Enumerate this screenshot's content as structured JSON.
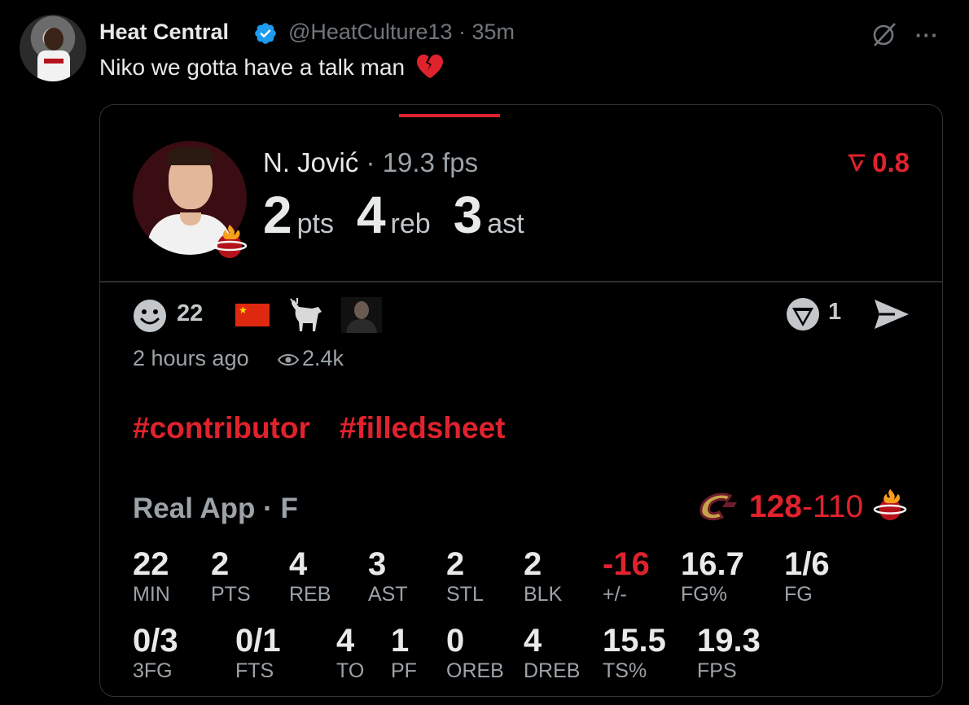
{
  "tweet": {
    "display_name": "Heat Central",
    "handle_time": "@HeatCulture13 · 35m",
    "text": "Niko we gotta have a talk man",
    "emoji_icon": "broken-heart",
    "actions": {
      "grok_icon": "grok-icon",
      "more_label": "···"
    }
  },
  "card": {
    "player_name": "N. Jović",
    "fps_text": "· 19.3 fps",
    "delta": "0.8",
    "big_stats": [
      {
        "value": "2",
        "unit": "pts"
      },
      {
        "value": "4",
        "unit": "reb"
      },
      {
        "value": "3",
        "unit": "ast"
      }
    ],
    "reaction_count": "22",
    "comment_count": "1",
    "time_ago": "2 hours ago",
    "views": "2.4k",
    "tags": [
      "#contributor",
      "#filledsheet"
    ],
    "source": "Real App · F",
    "score": {
      "home": "128",
      "sep": "-",
      "away": "110"
    },
    "stats_row1": [
      {
        "value": "22",
        "label": "MIN"
      },
      {
        "value": "2",
        "label": "PTS"
      },
      {
        "value": "4",
        "label": "REB"
      },
      {
        "value": "3",
        "label": "AST"
      },
      {
        "value": "2",
        "label": "STL"
      },
      {
        "value": "2",
        "label": "BLK"
      },
      {
        "value": "-16",
        "label": "+/-",
        "negative": true
      },
      {
        "value": "16.7",
        "label": "FG%"
      },
      {
        "value": "1/6",
        "label": "FG"
      }
    ],
    "stats_row2": [
      {
        "value": "0/3",
        "label": "3FG"
      },
      {
        "value": "0/1",
        "label": "FTS"
      },
      {
        "value": "4",
        "label": "TO"
      },
      {
        "value": "1",
        "label": "PF"
      },
      {
        "value": "0",
        "label": "OREB"
      },
      {
        "value": "4",
        "label": "DREB"
      },
      {
        "value": "15.5",
        "label": "TS%"
      },
      {
        "value": "19.3",
        "label": "FPS"
      }
    ]
  },
  "colors": {
    "accent_red": "#e0222d",
    "verified_blue": "#1d9bf0",
    "text": "#e7e9ea",
    "muted": "#71767b"
  }
}
